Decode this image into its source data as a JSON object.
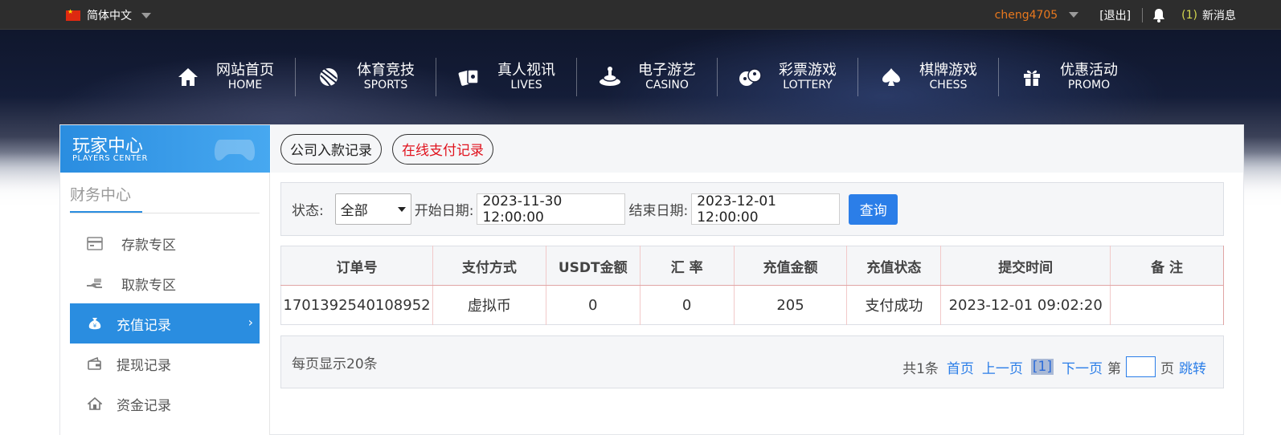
{
  "topbar": {
    "language": "简体中文",
    "username": "cheng4705",
    "logout": "[退出]",
    "message_count": "(1)",
    "message_label": "新消息"
  },
  "nav": [
    {
      "cn": "网站首页",
      "en": "HOME",
      "icon": "home-icon"
    },
    {
      "cn": "体育竞技",
      "en": "SPORTS",
      "icon": "basketball-icon"
    },
    {
      "cn": "真人视讯",
      "en": "LIVES",
      "icon": "cards-icon"
    },
    {
      "cn": "电子游艺",
      "en": "CASINO",
      "icon": "slot-icon"
    },
    {
      "cn": "彩票游戏",
      "en": "LOTTERY",
      "icon": "dice-icon"
    },
    {
      "cn": "棋牌游戏",
      "en": "CHESS",
      "icon": "spade-icon"
    },
    {
      "cn": "优惠活动",
      "en": "PROMO",
      "icon": "gift-icon"
    }
  ],
  "sidebar": {
    "title": "玩家中心",
    "subtitle": "PLAYERS CENTER",
    "section": "财务中心",
    "items": [
      {
        "label": "存款专区",
        "icon": "deposit-icon"
      },
      {
        "label": "取款专区",
        "icon": "withdraw-icon"
      },
      {
        "label": "充值记录",
        "icon": "moneybag-icon"
      },
      {
        "label": "提现记录",
        "icon": "wallet-icon"
      },
      {
        "label": "资金记录",
        "icon": "house-icon"
      }
    ]
  },
  "tabs": [
    "公司入款记录",
    "在线支付记录"
  ],
  "filter": {
    "status_label": "状态:",
    "status_value": "全部",
    "start_label": "开始日期:",
    "start_value": "2023-11-30 12:00:00",
    "end_label": "结束日期:",
    "end_value": "2023-12-01 12:00:00",
    "search_button": "查询"
  },
  "table": {
    "headers": [
      "订单号",
      "支付方式",
      "USDT金额",
      "汇 率",
      "充值金额",
      "充值状态",
      "提交时间",
      "备 注"
    ],
    "rows": [
      [
        "1701392540108952",
        "虚拟币",
        "0",
        "0",
        "205",
        "支付成功",
        "2023-12-01 09:02:20",
        ""
      ]
    ]
  },
  "pager": {
    "per_page": "每页显示20条",
    "total": "共1条",
    "first": "首页",
    "prev": "上一页",
    "current": "[1]",
    "next": "下一页",
    "page_prefix": "第",
    "page_suffix": "页",
    "jump": "跳转"
  },
  "colors": {
    "accent": "#2a8de0",
    "username": "#e8781e",
    "active_tab": "#e0121d",
    "button": "#2b7ee8"
  }
}
